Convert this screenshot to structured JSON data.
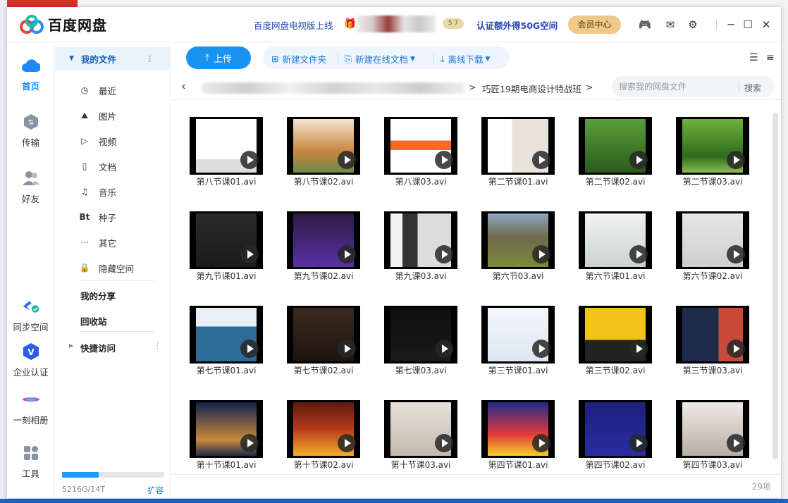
{
  "app": {
    "title": "百度网盘",
    "tv_link": "百度网盘电视版上线",
    "level_badge": "5 7",
    "verify_link": "认证额外得50G空间",
    "vip_label": "会员中心"
  },
  "rail": [
    {
      "label": "首页",
      "icon": "cloud-home-icon"
    },
    {
      "label": "传输",
      "icon": "transfer-icon"
    },
    {
      "label": "好友",
      "icon": "friends-icon"
    },
    {
      "label": "同步空间",
      "icon": "sync-space-icon"
    },
    {
      "label": "企业认证",
      "icon": "enterprise-verify-icon"
    },
    {
      "label": "一刻相册",
      "icon": "album-icon"
    },
    {
      "label": "工具",
      "icon": "tools-icon"
    }
  ],
  "nav": {
    "head": "我的文件",
    "items": [
      {
        "label": "最近",
        "icon": "clock-icon"
      },
      {
        "label": "图片",
        "icon": "image-icon"
      },
      {
        "label": "视频",
        "icon": "video-icon"
      },
      {
        "label": "文档",
        "icon": "document-icon"
      },
      {
        "label": "音乐",
        "icon": "headphones-icon"
      },
      {
        "label": "种子",
        "icon": "bt-icon"
      },
      {
        "label": "其它",
        "icon": "more-icon"
      },
      {
        "label": "隐藏空间",
        "icon": "lock-icon"
      }
    ],
    "share": "我的分享",
    "recycle": "回收站",
    "quick": "快捷访问",
    "quota": "5216G/14T",
    "quota_fraction": 0.36,
    "expand": "扩容"
  },
  "toolbar": {
    "upload": "上传",
    "new_folder": "新建文件夹",
    "new_doc": "新建在线文档",
    "offline": "离线下载"
  },
  "path": {
    "current": "巧匠19期电商设计特战班",
    "search_placeholder": "搜索我的网盘文件",
    "search_btn": "搜索"
  },
  "files": [
    {
      "name": "第八节课01.avi"
    },
    {
      "name": "第八节课02.avi"
    },
    {
      "name": "第八课03.avi"
    },
    {
      "name": "第二节课01.avi"
    },
    {
      "name": "第二节课02.avi"
    },
    {
      "name": "第二节课03.avi"
    },
    {
      "name": "第九节课01.avi"
    },
    {
      "name": "第九节课02.avi"
    },
    {
      "name": "第九课03.avi"
    },
    {
      "name": "第六节03.avi"
    },
    {
      "name": "第六节课01.avi"
    },
    {
      "name": "第六节课02.avi"
    },
    {
      "name": "第七节课01.avi"
    },
    {
      "name": "第七节课02.avi"
    },
    {
      "name": "第七课03.avi"
    },
    {
      "name": "第三节课01.avi"
    },
    {
      "name": "第三节课02.avi"
    },
    {
      "name": "第三节课03.avi"
    },
    {
      "name": "第十节课01.avi"
    },
    {
      "name": "第十节课02.avi"
    },
    {
      "name": "第十节课03.avi"
    },
    {
      "name": "第四节课01.avi"
    },
    {
      "name": "第四节课02.avi"
    },
    {
      "name": "第四节课03.avi"
    }
  ],
  "footer": {
    "count": "29项"
  },
  "colors": {
    "accent": "#1a92f0",
    "link": "#2447b6",
    "vip": "#efc98c"
  }
}
